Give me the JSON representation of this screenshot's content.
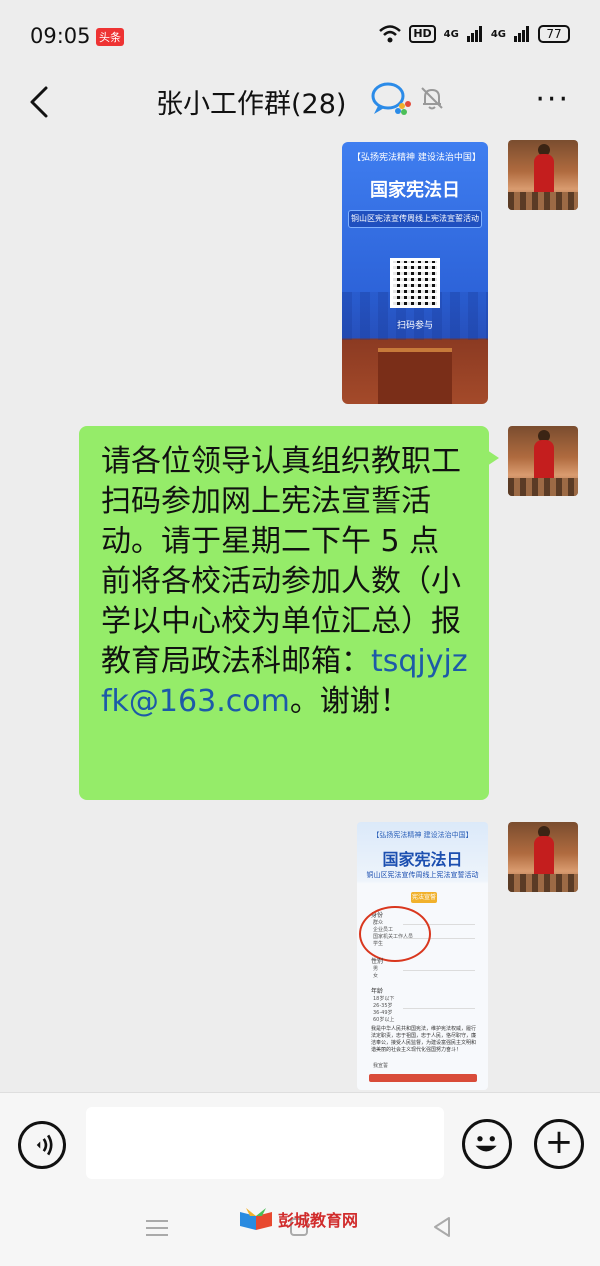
{
  "status_bar": {
    "time": "09:05",
    "badge": "头条",
    "network_hd": "HD",
    "signal_1": "4G",
    "signal_2": "4G",
    "battery": "77"
  },
  "header": {
    "title": "张小工作群(28)",
    "more_label": "···"
  },
  "messages": {
    "poster1": {
      "slogan": "【弘扬宪法精神 建设法治中国】",
      "headline": "国家宪法日",
      "subtitle": "铜山区宪法宣传周线上宪法宣誓活动",
      "scan_label": "扫码参与"
    },
    "text_message": {
      "body": "请各位领导认真组织教职工扫码参加网上宪法宣誓活动。请于星期二下午 5 点前将各校活动参加人数（小学以中心校为单位汇总）报教育局政法科邮箱：",
      "email": "tsqjyjzfk@163.com",
      "tail": "。谢谢！"
    },
    "poster2": {
      "slogan": "【弘扬宪法精神 建设法治中国】",
      "headline": "国家宪法日",
      "subtitle": "铜山区宪法宣传周线上宪法宣誓活动",
      "tag": "宪法宣誓",
      "identity_label": "身份",
      "identity_options": [
        "群众",
        "企业员工",
        "国家机关工作人员",
        "学生"
      ],
      "gender_label": "性别",
      "gender_options": [
        "男",
        "女"
      ],
      "age_label": "年龄",
      "age_options": [
        "18岁以下",
        "26-35岁",
        "36-49岁",
        "60岁以上"
      ],
      "oath_text": "我是中华人民共和国宪法，维护宪法权威，履行法定职责，忠于祖国，忠于人民，恪尽职守，廉洁奉公，接受人民监督，为建设富强民主文明和谐美丽的社会主义现代化强国努力奋斗！",
      "agree_option": "我宣誓"
    }
  },
  "bottom": {
    "logo_text": "彭城教育网"
  },
  "colors": {
    "bubble_green": "#95ec69",
    "background": "#ededed",
    "link_blue": "#1d5aa8"
  }
}
